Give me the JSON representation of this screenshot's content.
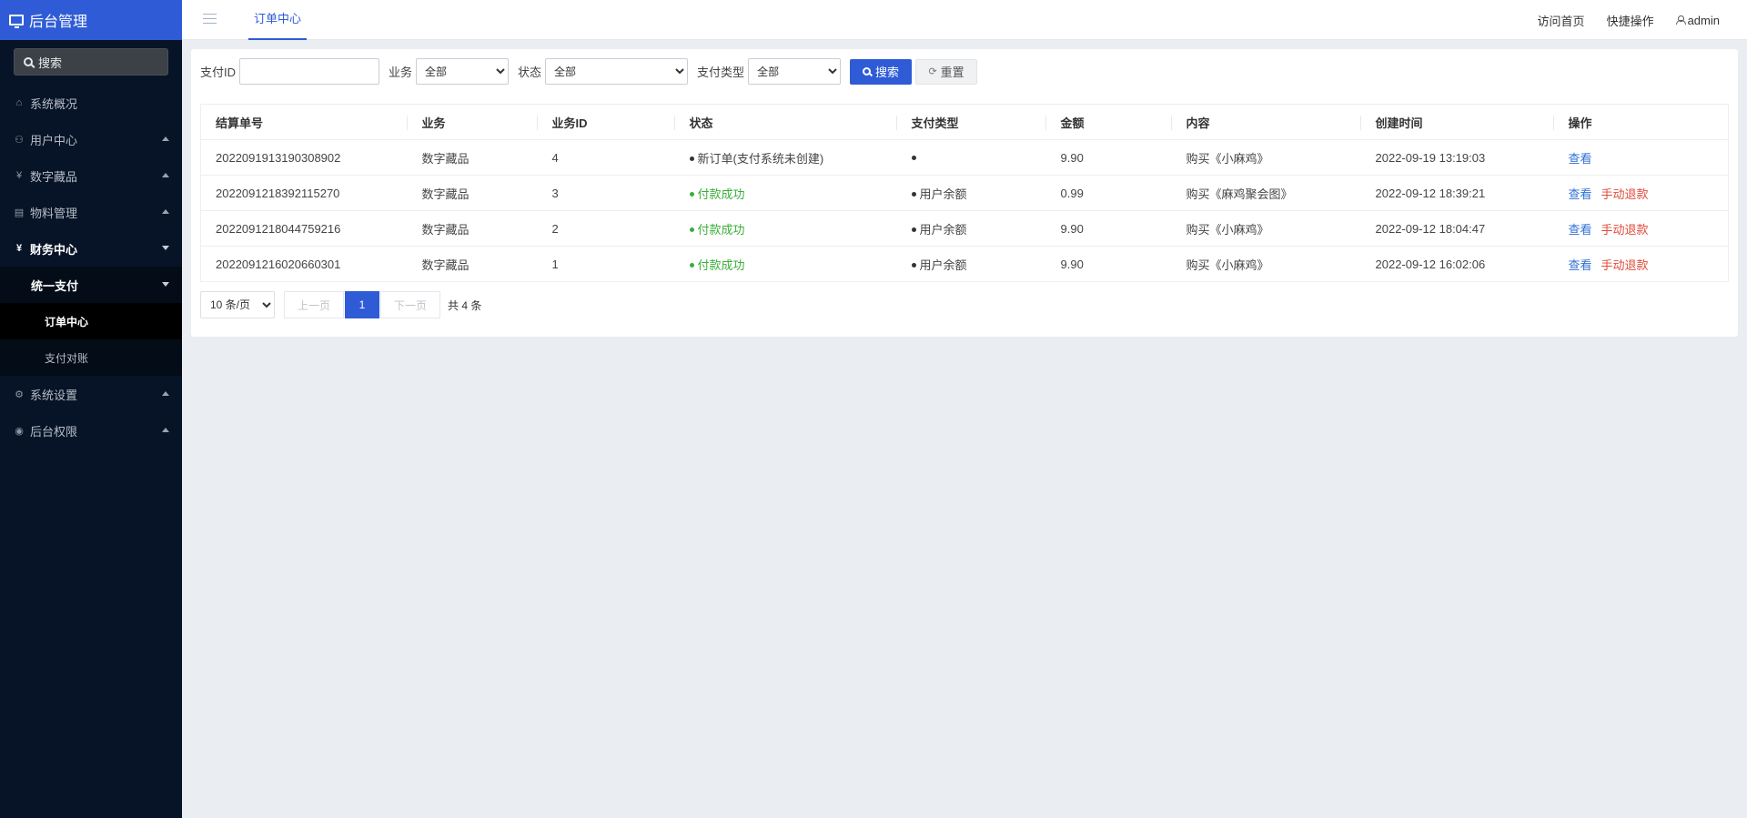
{
  "sidebar": {
    "brand": "后台管理",
    "search_label": "搜索",
    "items": [
      {
        "label": "系统概况",
        "icon": "home-icon"
      },
      {
        "label": "用户中心",
        "icon": "users-icon"
      },
      {
        "label": "数字藏品",
        "icon": "yen-icon"
      },
      {
        "label": "物料管理",
        "icon": "document-icon"
      },
      {
        "label": "财务中心",
        "icon": "yen-icon"
      },
      {
        "label": "统一支付"
      },
      {
        "label": "订单中心"
      },
      {
        "label": "支付对账"
      },
      {
        "label": "系统设置",
        "icon": "gear-icon"
      },
      {
        "label": "后台权限",
        "icon": "user-circle-icon"
      }
    ]
  },
  "topbar": {
    "tab": "订单中心",
    "visit_home": "访问首页",
    "quick_ops": "快捷操作",
    "user": "admin"
  },
  "filters": {
    "pay_id_label": "支付ID",
    "pay_id_value": "",
    "business_label": "业务",
    "business_value": "全部",
    "status_label": "状态",
    "status_value": "全部",
    "pay_type_label": "支付类型",
    "pay_type_value": "全部",
    "search_btn": "搜索",
    "reset_btn": "重置"
  },
  "table": {
    "headers": [
      "结算单号",
      "业务",
      "业务ID",
      "状态",
      "支付类型",
      "金额",
      "内容",
      "创建时间",
      "操作"
    ],
    "rows": [
      {
        "order_no": "2022091913190308902",
        "business": "数字藏品",
        "biz_id": "4",
        "status": "新订单(支付系统未创建)",
        "pay_type": "",
        "amount": "9.90",
        "content": "购买《小麻鸡》",
        "created": "2022-09-19 13:19:03",
        "view": "查看",
        "refund": ""
      },
      {
        "order_no": "2022091218392115270",
        "business": "数字藏品",
        "biz_id": "3",
        "status": "付款成功",
        "pay_type": "用户余额",
        "amount": "0.99",
        "content": "购买《麻鸡聚会图》",
        "created": "2022-09-12 18:39:21",
        "view": "查看",
        "refund": "手动退款"
      },
      {
        "order_no": "2022091218044759216",
        "business": "数字藏品",
        "biz_id": "2",
        "status": "付款成功",
        "pay_type": "用户余额",
        "amount": "9.90",
        "content": "购买《小麻鸡》",
        "created": "2022-09-12 18:04:47",
        "view": "查看",
        "refund": "手动退款"
      },
      {
        "order_no": "2022091216020660301",
        "business": "数字藏品",
        "biz_id": "1",
        "status": "付款成功",
        "pay_type": "用户余额",
        "amount": "9.90",
        "content": "购买《小麻鸡》",
        "created": "2022-09-12 16:02:06",
        "view": "查看",
        "refund": "手动退款"
      }
    ]
  },
  "pager": {
    "page_size": "10 条/页",
    "prev": "上一页",
    "current": "1",
    "next": "下一页",
    "total": "共 4 条"
  },
  "colors": {
    "accent": "#2f5cd6",
    "success": "#3aae3a",
    "danger": "#e04a3a",
    "sidebar_bg": "#071427"
  }
}
